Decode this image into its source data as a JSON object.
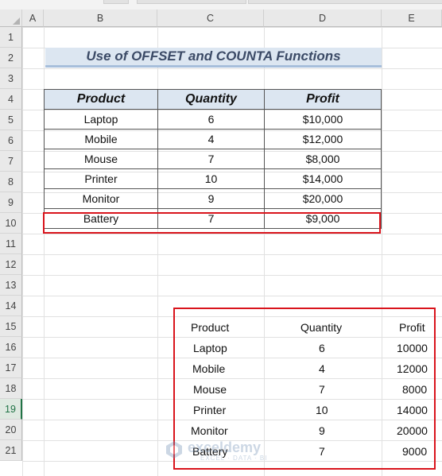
{
  "columns": [
    "A",
    "B",
    "C",
    "D",
    "E"
  ],
  "rows": [
    "1",
    "2",
    "3",
    "4",
    "5",
    "6",
    "7",
    "8",
    "9",
    "10",
    "11",
    "12",
    "13",
    "14",
    "15",
    "16",
    "17",
    "18",
    "19",
    "20",
    "21"
  ],
  "selected_row": "19",
  "title": "Use of OFFSET and COUNTA Functions",
  "table": {
    "headers": [
      "Product",
      "Quantity",
      "Profit"
    ],
    "rows": [
      [
        "Laptop",
        "6",
        "$10,000"
      ],
      [
        "Mobile",
        "4",
        "$12,000"
      ],
      [
        "Mouse",
        "7",
        "$8,000"
      ],
      [
        "Printer",
        "10",
        "$14,000"
      ],
      [
        "Monitor",
        "9",
        "$20,000"
      ],
      [
        "Battery",
        "7",
        "$9,000"
      ]
    ]
  },
  "spill": {
    "headers": [
      "Product",
      "Quantity",
      "Profit"
    ],
    "rows": [
      [
        "Laptop",
        "6",
        "10000"
      ],
      [
        "Mobile",
        "4",
        "12000"
      ],
      [
        "Mouse",
        "7",
        "8000"
      ],
      [
        "Printer",
        "10",
        "14000"
      ],
      [
        "Monitor",
        "9",
        "20000"
      ],
      [
        "Battery",
        "7",
        "9000"
      ]
    ]
  },
  "highlight_color": "#d9141c",
  "header_fill": "#dce6f1",
  "watermark": {
    "name": "exceldemy",
    "tagline": "EXCEL · DATA · BI"
  }
}
